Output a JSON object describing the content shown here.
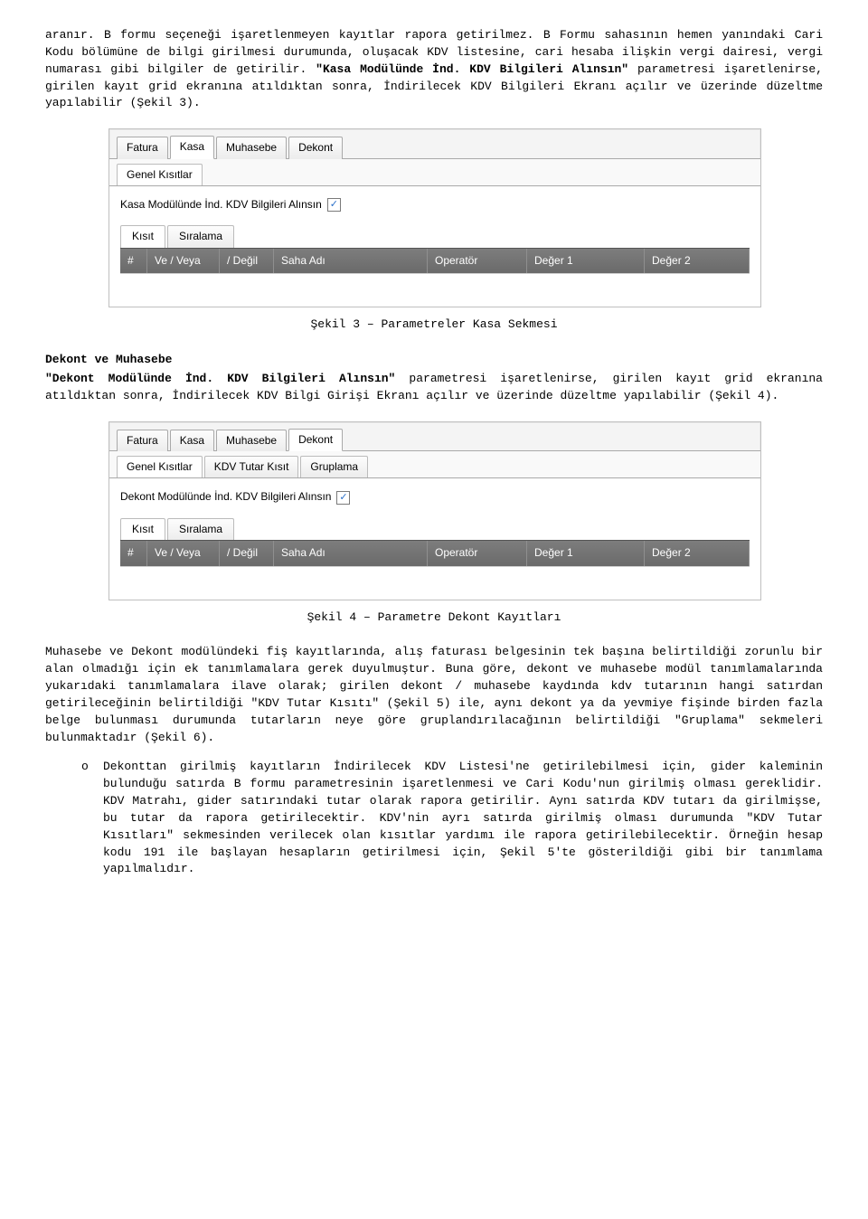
{
  "paragraph1_part1": "aranır. B formu seçeneği işaretlenmeyen kayıtlar rapora getirilmez. B Formu sahasının hemen yanındaki Cari Kodu bölümüne de bilgi girilmesi durumunda, oluşacak KDV listesine, cari hesaba ilişkin vergi dairesi, vergi numarası gibi bilgiler de getirilir.",
  "paragraph1_bold1": "\"Kasa Modülünde İnd. KDV Bilgileri Alınsın\"",
  "paragraph1_part2": " parametresi işaretlenirse, girilen kayıt grid ekranına atıldıktan sonra, İndirilecek KDV Bilgileri Ekranı açılır ve üzerinde düzeltme yapılabilir (Şekil 3).",
  "fig3": {
    "tabs": {
      "t1": "Fatura",
      "t2": "Kasa",
      "t3": "Muhasebe",
      "t4": "Dekont"
    },
    "subtab": "Genel Kısıtlar",
    "checkbox_label": "Kasa Modülünde İnd. KDV Bilgileri Alınsın",
    "inner_tabs": {
      "a": "Kısıt",
      "b": "Sıralama"
    },
    "cols": {
      "hash": "#",
      "veveya": "Ve / Veya",
      "degil": "/ Değil",
      "saha": "Saha Adı",
      "op": "Operatör",
      "d1": "Değer 1",
      "d2": "Değer 2"
    }
  },
  "caption3": "Şekil 3 – Parametreler Kasa Sekmesi",
  "section2_head": "Dekont ve Muhasebe",
  "paragraph2_bold": "\"Dekont Modülünde İnd. KDV Bilgileri Alınsın\"",
  "paragraph2_rest": " parametresi işaretlenirse, girilen kayıt grid ekranına atıldıktan sonra, İndirilecek KDV Bilgi Girişi Ekranı açılır ve üzerinde düzeltme yapılabilir (Şekil 4).",
  "fig4": {
    "tabs": {
      "t1": "Fatura",
      "t2": "Kasa",
      "t3": "Muhasebe",
      "t4": "Dekont"
    },
    "subtabs": {
      "a": "Genel Kısıtlar",
      "b": "KDV Tutar Kısıt",
      "c": "Gruplama"
    },
    "checkbox_label": "Dekont Modülünde  İnd. KDV Bilgileri Alınsın",
    "inner_tabs": {
      "a": "Kısıt",
      "b": "Sıralama"
    },
    "cols": {
      "hash": "#",
      "veveya": "Ve / Veya",
      "degil": "/ Değil",
      "saha": "Saha Adı",
      "op": "Operatör",
      "d1": "Değer 1",
      "d2": "Değer 2"
    }
  },
  "caption4": "Şekil 4 – Parametre Dekont Kayıtları",
  "paragraph3": "Muhasebe ve Dekont modülündeki fiş kayıtlarında, alış faturası belgesinin tek başına belirtildiği zorunlu bir alan olmadığı için ek tanımlamalara gerek duyulmuştur. Buna göre, dekont ve muhasebe modül tanımlamalarında yukarıdaki tanımlamalara ilave olarak; girilen dekont / muhasebe kaydında kdv tutarının hangi satırdan getirileceğinin belirtildiği \"KDV Tutar Kısıtı\" (Şekil 5) ile, aynı dekont ya da yevmiye fişinde birden fazla belge bulunması durumunda tutarların neye göre gruplandırılacağının belirtildiği \"Gruplama\" sekmeleri bulunmaktadır (Şekil 6).",
  "list_marker": "o",
  "list_item": "Dekonttan girilmiş kayıtların İndirilecek KDV Listesi'ne getirilebilmesi için, gider kaleminin bulunduğu satırda B formu parametresinin işaretlenmesi ve Cari Kodu'nun girilmiş olması gereklidir. KDV Matrahı, gider satırındaki tutar olarak rapora getirilir.  Aynı satırda KDV tutarı da girilmişse, bu tutar da rapora getirilecektir.  KDV'nin ayrı satırda girilmiş olması durumunda \"KDV Tutar Kısıtları\" sekmesinden verilecek olan kısıtlar yardımı ile rapora getirilebilecektir. Örneğin hesap kodu 191 ile başlayan hesapların getirilmesi için, Şekil 5'te gösterildiği gibi bir tanımlama yapılmalıdır."
}
